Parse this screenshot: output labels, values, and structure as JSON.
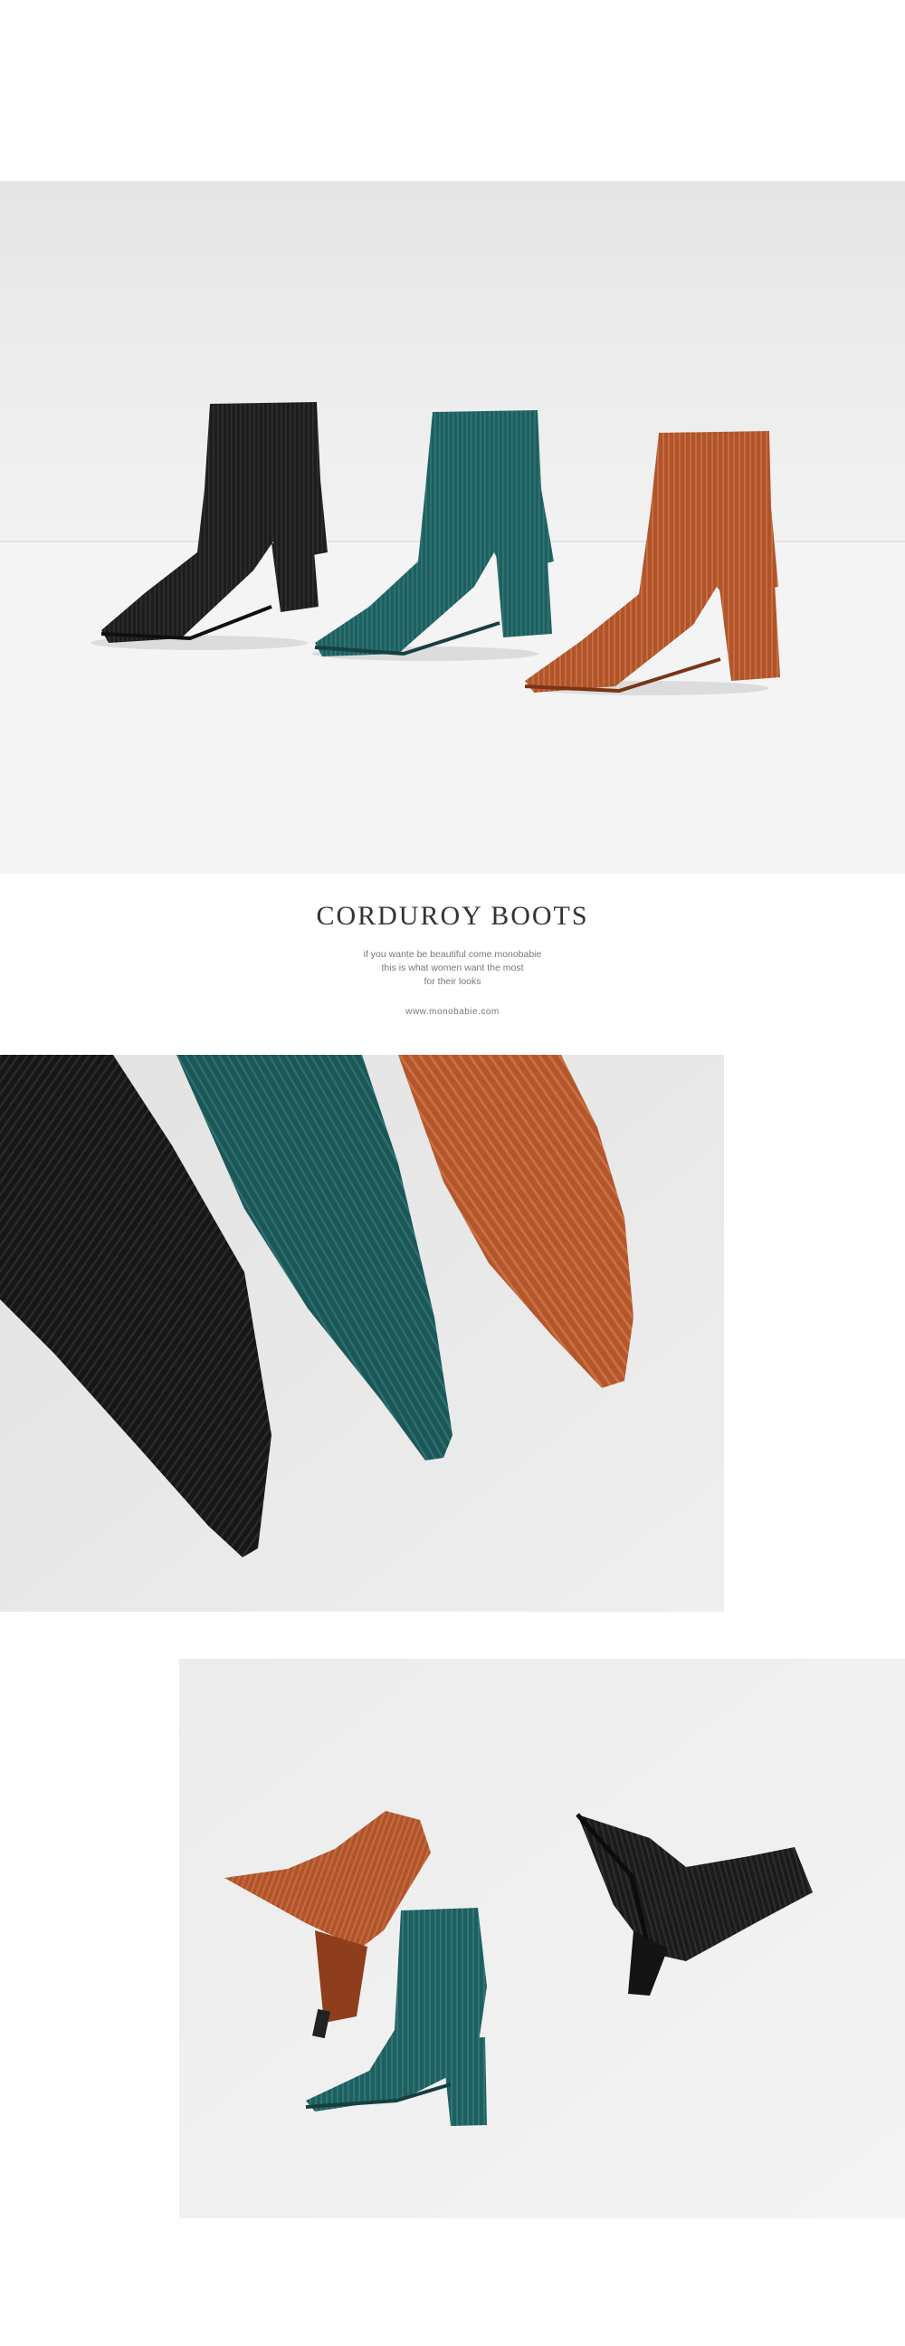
{
  "product": {
    "title": "Corduroy Boots",
    "tagline": [
      "if you wante be beautiful come monobabie",
      "this is what women want the most",
      "for their looks"
    ],
    "website": "www.monobabie.com"
  },
  "colors": {
    "black": "#1d1d1d",
    "teal": "#1f5f5f",
    "rust": "#b0542b",
    "backdrop": "#efefef"
  },
  "photos": [
    {
      "name": "three boots standing side by side"
    },
    {
      "name": "close-up of pointed corduroy toes"
    },
    {
      "name": "flat-lay of three boots"
    }
  ]
}
